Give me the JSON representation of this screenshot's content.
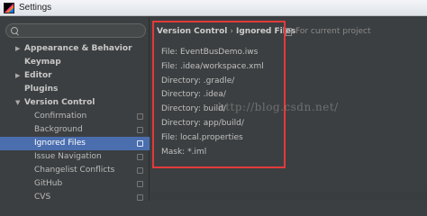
{
  "window": {
    "title": "Settings"
  },
  "search": {
    "placeholder": "",
    "value": ""
  },
  "sidebar": {
    "items": [
      {
        "label": "Appearance & Behavior",
        "level": 0,
        "expandable": true,
        "expanded": false,
        "bold": true
      },
      {
        "label": "Keymap",
        "level": 0,
        "expandable": false,
        "bold": true
      },
      {
        "label": "Editor",
        "level": 0,
        "expandable": true,
        "expanded": false,
        "bold": true
      },
      {
        "label": "Plugins",
        "level": 0,
        "expandable": false,
        "bold": true
      },
      {
        "label": "Version Control",
        "level": 0,
        "expandable": true,
        "expanded": true,
        "bold": true
      },
      {
        "label": "Confirmation",
        "level": 1,
        "project": true
      },
      {
        "label": "Background",
        "level": 1,
        "project": true
      },
      {
        "label": "Ignored Files",
        "level": 1,
        "project": true,
        "selected": true
      },
      {
        "label": "Issue Navigation",
        "level": 1,
        "project": true
      },
      {
        "label": "Changelist Conflicts",
        "level": 1,
        "project": true
      },
      {
        "label": "GitHub",
        "level": 1,
        "project": true
      },
      {
        "label": "CVS",
        "level": 1,
        "project": true
      }
    ]
  },
  "breadcrumb": {
    "parent": "Version Control",
    "separator": "›",
    "current": "Ignored Files"
  },
  "scope": {
    "label": "For current project"
  },
  "ignored": {
    "entries": [
      "File: EventBusDemo.iws",
      "File: .idea/workspace.xml",
      "Directory: .gradle/",
      "Directory: .idea/",
      "Directory: build/",
      "Directory: app/build/",
      "File: local.properties",
      "Mask: *.iml"
    ]
  },
  "watermark": {
    "text": "http://blog.csdn.net/"
  },
  "colors": {
    "background": "#3c3f41",
    "selection": "#4b6eaf",
    "highlight_border": "#e23a3a"
  }
}
